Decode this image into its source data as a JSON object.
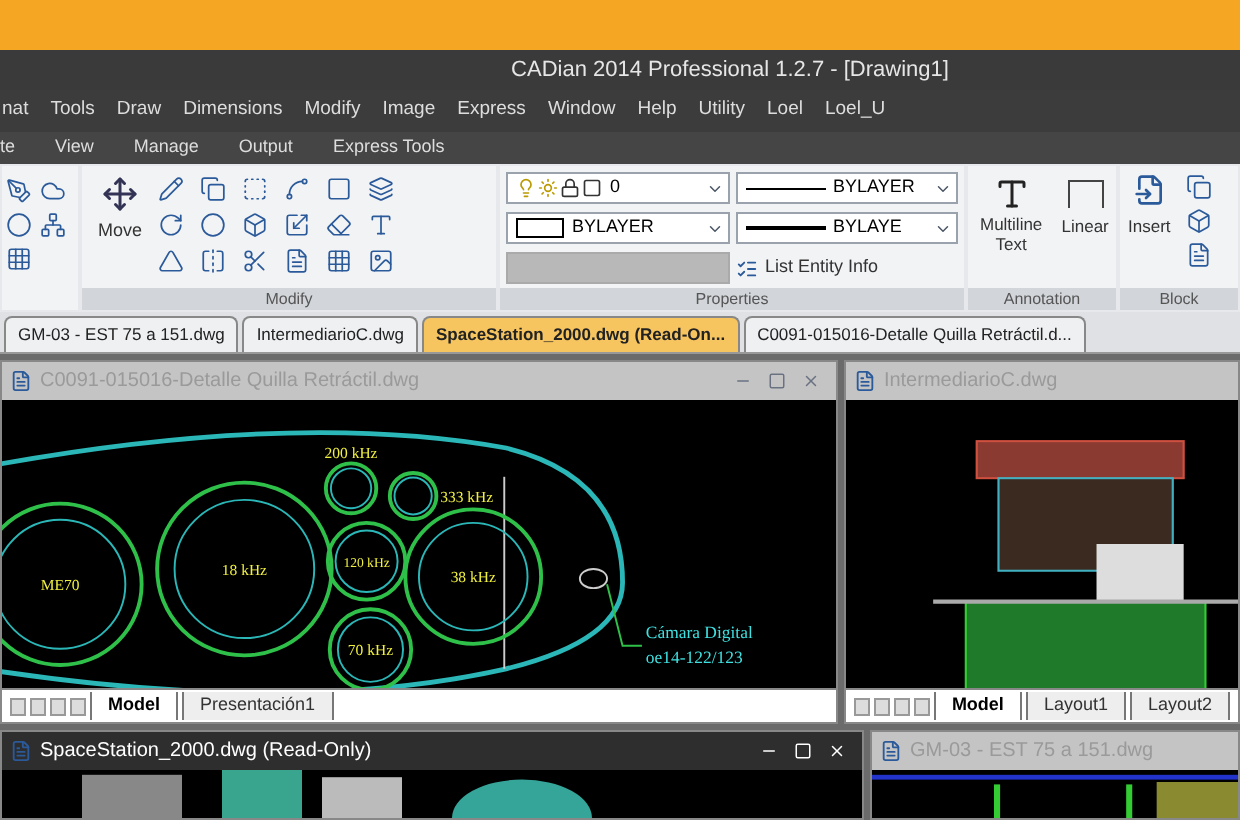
{
  "title_bar": {
    "title": "CADian 2014 Professional 1.2.7 - [Drawing1]"
  },
  "menu": [
    "nat",
    "Tools",
    "Draw",
    "Dimensions",
    "Modify",
    "Image",
    "Express",
    "Window",
    "Help",
    "Utility",
    "Loel",
    "Loel_U"
  ],
  "ribbon_tabs": [
    "te",
    "View",
    "Manage",
    "Output",
    "Express Tools"
  ],
  "ribbon": {
    "modify": {
      "label": "Modify",
      "move": "Move"
    },
    "properties": {
      "label": "Properties",
      "layer": "0",
      "color_field": "BYLAYER",
      "linetype": "BYLAYER",
      "lineweight": "BYLAYE",
      "list_button": "List Entity Info"
    },
    "annotation": {
      "label": "Annotation",
      "text_button": "Multiline Text",
      "dim_button": "Linear"
    },
    "block": {
      "label": "Block",
      "insert": "Insert"
    }
  },
  "doc_tabs": [
    {
      "label": "GM-03 - EST 75 a 151.dwg",
      "selected": false
    },
    {
      "label": "IntermediarioC.dwg",
      "selected": false
    },
    {
      "label": "SpaceStation_2000.dwg (Read-On...",
      "selected": true
    },
    {
      "label": "C0091-015016-Detalle Quilla Retráctil.d...",
      "selected": false
    }
  ],
  "windows": [
    {
      "title": "C0091-015016-Detalle Quilla Retráctil.dwg",
      "active": false,
      "kind": "sonar",
      "labels": [
        "ME70",
        "18 kHz",
        "200 kHz",
        "333 kHz",
        "120 kHz",
        "38 kHz",
        "70 kHz",
        "Cámara Digital",
        "oe14-122/123"
      ],
      "layout_tabs": [
        {
          "label": "Model",
          "selected": true
        },
        {
          "label": "Presentación1",
          "selected": false
        }
      ]
    },
    {
      "title": "IntermediarioC.dwg",
      "active": false,
      "kind": "elevation",
      "layout_tabs": [
        {
          "label": "Model",
          "selected": true
        },
        {
          "label": "Layout1",
          "selected": false
        },
        {
          "label": "Layout2",
          "selected": false
        }
      ]
    },
    {
      "title": "SpaceStation_2000.dwg (Read-Only)",
      "active": true,
      "kind": "station"
    },
    {
      "title": "GM-03 - EST 75 a 151.dwg",
      "active": false,
      "kind": "plan"
    }
  ]
}
